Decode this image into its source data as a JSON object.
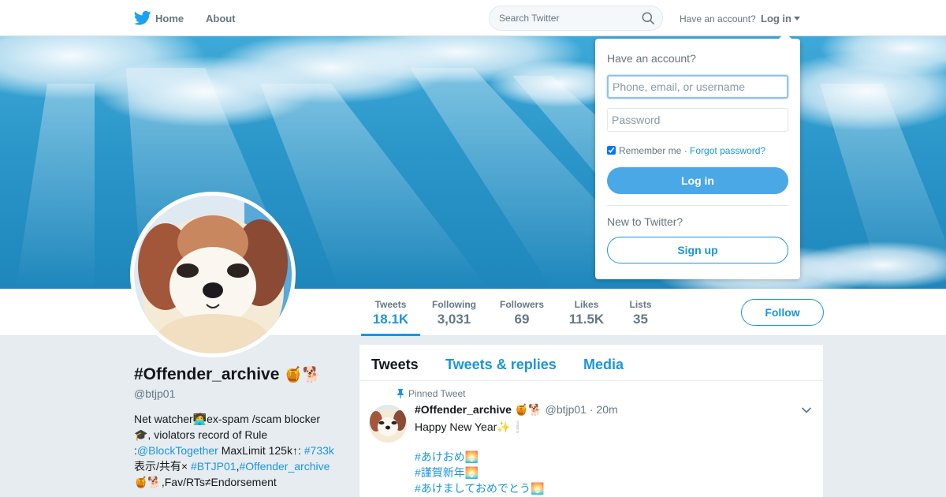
{
  "nav": {
    "home_label": "Home",
    "about_label": "About",
    "search_placeholder": "Search Twitter",
    "have_account_text": "Have an account?",
    "login_label": "Log in"
  },
  "profile_nav": {
    "stats": [
      {
        "label": "Tweets",
        "value": "18.1K"
      },
      {
        "label": "Following",
        "value": "3,031"
      },
      {
        "label": "Followers",
        "value": "69"
      },
      {
        "label": "Likes",
        "value": "11.5K"
      },
      {
        "label": "Lists",
        "value": "35"
      }
    ],
    "follow_label": "Follow"
  },
  "profile": {
    "name": "#Offender_archive",
    "name_emoji": "🍯🐕",
    "handle": "@btjp01",
    "bio": {
      "line1": "Net watcher🧑‍💻ex-spam /scam blocker",
      "line2": "🎓, violators record of Rule",
      "line3_prefix": ":",
      "line3_link": "@BlockTogether",
      "line3_mid": " MaxLimit 125k↑: ",
      "line3_tag": "#733k",
      "line4_prefix": "表示/共有× ",
      "line4_tag1": "#BTJP01",
      "line4_sep": ",",
      "line4_tag2": "#Offender_archive",
      "line5": "🍯🐕,Fav/RTs≠Endorsement"
    }
  },
  "timeline": {
    "tabs": [
      "Tweets",
      "Tweets & replies",
      "Media"
    ],
    "pinned_label": "Pinned Tweet",
    "tweet": {
      "name": "#Offender_archive",
      "name_emoji": "🍯🐕",
      "handle": "@btjp01",
      "separator": "·",
      "time": "20m",
      "text": "Happy New Year✨❕",
      "hashtags": [
        "#あけおめ🌅",
        "#謹賀新年🌅",
        "#あけましておめでとう🌅"
      ]
    }
  },
  "login_dropdown": {
    "title": "Have an account?",
    "username_placeholder": "Phone, email, or username",
    "password_placeholder": "Password",
    "remember_label": "Remember me",
    "separator": "·",
    "forgot_label": "Forgot password?",
    "login_button": "Log in",
    "new_to_twitter": "New to Twitter?",
    "signup_button": "Sign up"
  },
  "colors": {
    "twitter_blue": "#1b95e0",
    "login_button_bg": "#4aa8e7",
    "page_bg": "#e6ecf0"
  },
  "icons": [
    "twitter-bird-icon",
    "search-icon",
    "caret-down-icon",
    "pin-icon",
    "chevron-down-icon"
  ]
}
